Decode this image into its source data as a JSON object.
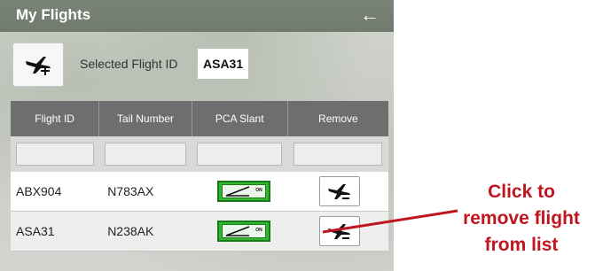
{
  "panel": {
    "title": "My Flights",
    "back_icon": "back-arrow-icon"
  },
  "selection": {
    "add_icon": "add-flight-icon",
    "label": "Selected Flight ID",
    "value": "ASA31"
  },
  "table": {
    "headers": [
      "Flight ID",
      "Tail Number",
      "PCA Slant",
      "Remove"
    ],
    "rows": [
      {
        "flight_id": "ABX904",
        "tail_number": "N783AX",
        "pca_slant": "ON",
        "remove_icon": "remove-flight-icon"
      },
      {
        "flight_id": "ASA31",
        "tail_number": "N238AK",
        "pca_slant": "ON",
        "remove_icon": "remove-flight-icon"
      }
    ]
  },
  "annotation": {
    "lines": [
      "Click to",
      "remove flight",
      "from list"
    ]
  },
  "colors": {
    "title_bar": "#6f7a6c",
    "header": "#6e6e6e",
    "toggle_on": "#2eb82e",
    "callout": "#c0151f"
  }
}
